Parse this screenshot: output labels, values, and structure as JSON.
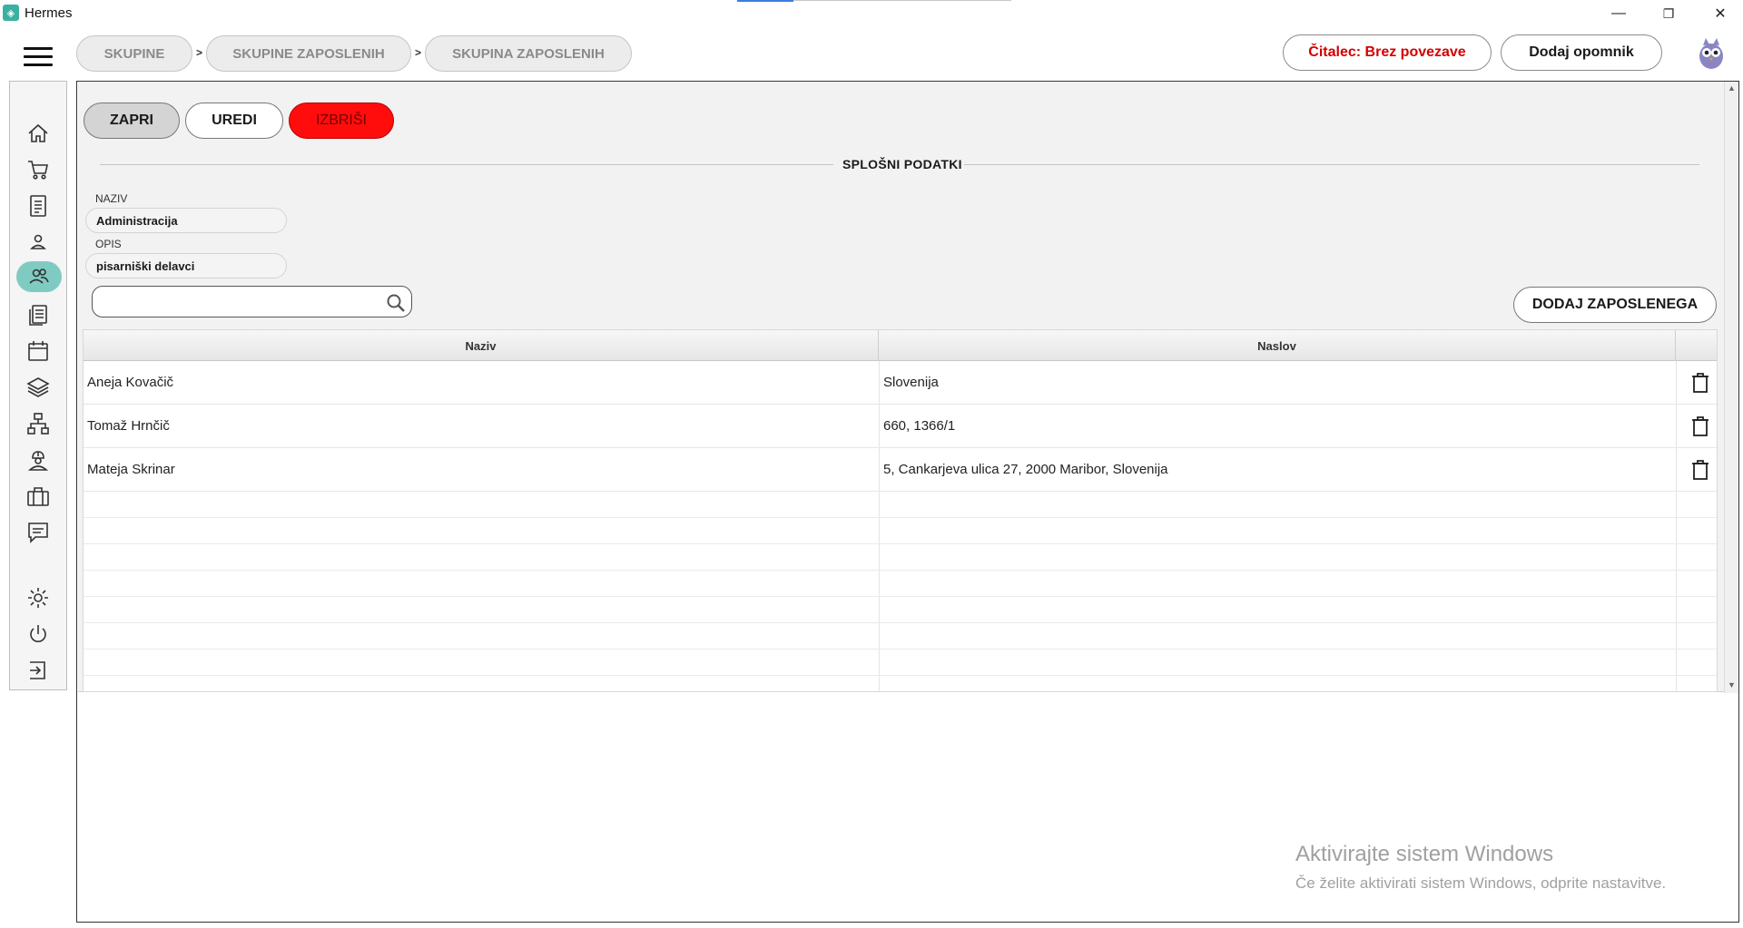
{
  "window": {
    "title": "Hermes",
    "minimize": "—",
    "restore": "❐",
    "close": "✕"
  },
  "breadcrumbs": [
    {
      "label": "SKUPINE"
    },
    {
      "label": "SKUPINE ZAPOSLENIH"
    },
    {
      "label": "SKUPINA ZAPOSLENIH"
    }
  ],
  "breadcrumb_separator": ">",
  "header": {
    "reader_status": "Čitalec: Brez povezave",
    "reader_status_color": "#d40000",
    "add_reminder": "Dodaj opomnik"
  },
  "sidebar": {
    "items": [
      {
        "icon": "home-icon"
      },
      {
        "icon": "cart-icon"
      },
      {
        "icon": "document-icon"
      },
      {
        "icon": "person-icon"
      },
      {
        "icon": "group-icon",
        "active": true
      },
      {
        "icon": "documents-icon"
      },
      {
        "icon": "calendar-icon"
      },
      {
        "icon": "layers-icon"
      },
      {
        "icon": "network-icon"
      },
      {
        "icon": "worker-icon"
      },
      {
        "icon": "briefcase-icon"
      },
      {
        "icon": "chat-icon"
      },
      {
        "icon": "gear-icon"
      },
      {
        "icon": "power-icon"
      },
      {
        "icon": "logout-icon"
      }
    ],
    "active_color": "#7fcbc2"
  },
  "actions": {
    "close": "ZAPRI",
    "edit": "UREDI",
    "delete": "IZBRIŠI",
    "delete_color": "#ff0c0c"
  },
  "section_title": "SPLOŠNI PODATKI",
  "form": {
    "name_label": "NAZIV",
    "name_value": "Administracija",
    "desc_label": "OPIS",
    "desc_value": "pisarniški delavci"
  },
  "search": {
    "value": ""
  },
  "add_employee": "DODAJ ZAPOSLENEGA",
  "table": {
    "columns": [
      "Naziv",
      "Naslov"
    ],
    "rows": [
      {
        "name": "Aneja  Kovačič",
        "address": "Slovenija"
      },
      {
        "name": "Tomaž Hrnčič",
        "address": "660, 1366/1"
      },
      {
        "name": "Mateja Skrinar",
        "address": "5, Cankarjeva ulica 27, 2000 Maribor, Slovenija"
      }
    ]
  },
  "watermark": {
    "line1": "Aktivirajte sistem Windows",
    "line2": "Če želite aktivirati sistem Windows, odprite nastavitve."
  }
}
